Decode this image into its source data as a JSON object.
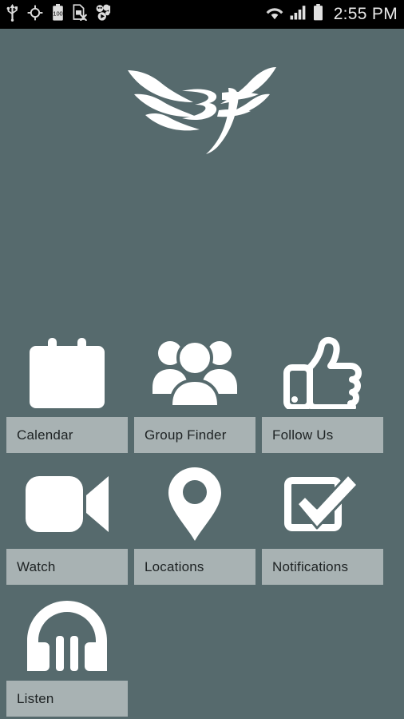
{
  "status_bar": {
    "left_icons": [
      {
        "name": "usb-icon",
        "label": "USB"
      },
      {
        "name": "gps-icon",
        "label": "GPS"
      },
      {
        "name": "battery-100-icon",
        "label": "100"
      },
      {
        "name": "sim-card-error-icon",
        "label": "SIM card error"
      },
      {
        "name": "music-icon",
        "label": "Music"
      }
    ],
    "right_icons": [
      {
        "name": "wifi-icon",
        "label": "Wi-Fi"
      },
      {
        "name": "cell-signal-icon",
        "label": "Signal"
      },
      {
        "name": "battery-icon",
        "label": "Battery"
      }
    ],
    "clock": "2:55 PM",
    "background_color": "#000000",
    "text_color": "#e8e8e8"
  },
  "logo": {
    "name": "bf-wings-logo",
    "alt": "BF",
    "color": "#ffffff"
  },
  "theme": {
    "background_color": "#566a6d",
    "label_bar_color": "#a8b2b3",
    "label_text_color": "#1d2223",
    "icon_color": "#ffffff"
  },
  "grid": {
    "tiles": [
      {
        "label": "Calendar",
        "icon": "calendar-icon"
      },
      {
        "label": "Group Finder",
        "icon": "group-people-icon"
      },
      {
        "label": "Follow Us",
        "icon": "thumbs-up-icon"
      },
      {
        "label": "Watch",
        "icon": "video-camera-icon"
      },
      {
        "label": "Locations",
        "icon": "map-pin-icon"
      },
      {
        "label": "Notifications",
        "icon": "checkbox-check-icon"
      },
      {
        "label": "Listen",
        "icon": "headphones-icon"
      }
    ]
  }
}
